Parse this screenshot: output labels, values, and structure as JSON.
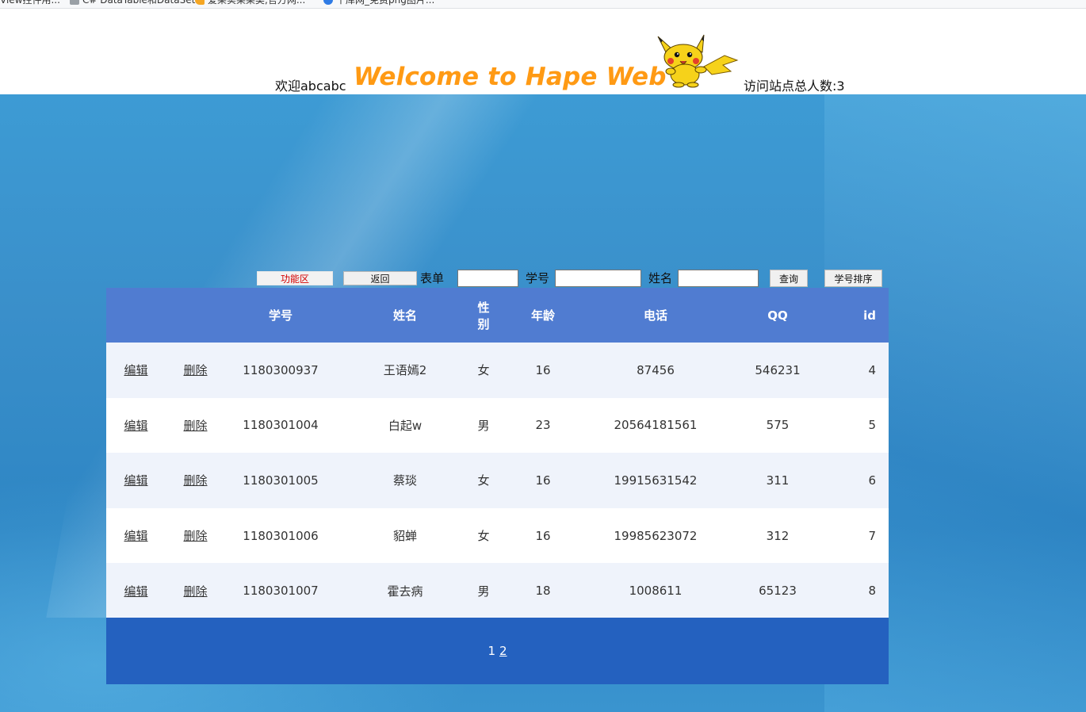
{
  "bookmarks": [
    {
      "label": "View控件用..."
    },
    {
      "label": "C# DataTable和DataSet..."
    },
    {
      "label": "爱果实果果类,官方网..."
    },
    {
      "label": "千库网_免费png图片..."
    }
  ],
  "header": {
    "welcome_user": "欢迎abcabc",
    "site_title": "Welcome to Hape Web",
    "visitor_count": "访问站点总人数:3"
  },
  "toolbar": {
    "function_area_label": "功能区",
    "back_label": "返回",
    "form_label": "表单",
    "form_value": "",
    "student_id_label": "学号",
    "student_id_value": "",
    "name_label": "姓名",
    "name_value": "",
    "search_label": "查询",
    "sort_label": "学号排序"
  },
  "table": {
    "columns": [
      "",
      "",
      "学号",
      "姓名",
      "性别",
      "年龄",
      "电话",
      "QQ",
      "id"
    ],
    "edit_label": "编辑",
    "delete_label": "删除",
    "rows": [
      {
        "student_id": "1180300937",
        "name": "王语嫣2",
        "gender": "女",
        "age": "16",
        "phone": "87456",
        "qq": "546231",
        "id": "4"
      },
      {
        "student_id": "1180301004",
        "name": "白起w",
        "gender": "男",
        "age": "23",
        "phone": "20564181561",
        "qq": "575",
        "id": "5"
      },
      {
        "student_id": "1180301005",
        "name": "蔡琰",
        "gender": "女",
        "age": "16",
        "phone": "19915631542",
        "qq": "311",
        "id": "6"
      },
      {
        "student_id": "1180301006",
        "name": "貂蝉",
        "gender": "女",
        "age": "16",
        "phone": "19985623072",
        "qq": "312",
        "id": "7"
      },
      {
        "student_id": "1180301007",
        "name": "霍去病",
        "gender": "男",
        "age": "18",
        "phone": "1008611",
        "qq": "65123",
        "id": "8"
      }
    ]
  },
  "pager": {
    "current_page": "1",
    "pages": [
      "2"
    ]
  },
  "colors": {
    "header_row": "#507cd1",
    "alt_row": "#eff3fb",
    "pager": "#2461bf",
    "title": "#ff9a14",
    "function_label": "#d40000"
  }
}
